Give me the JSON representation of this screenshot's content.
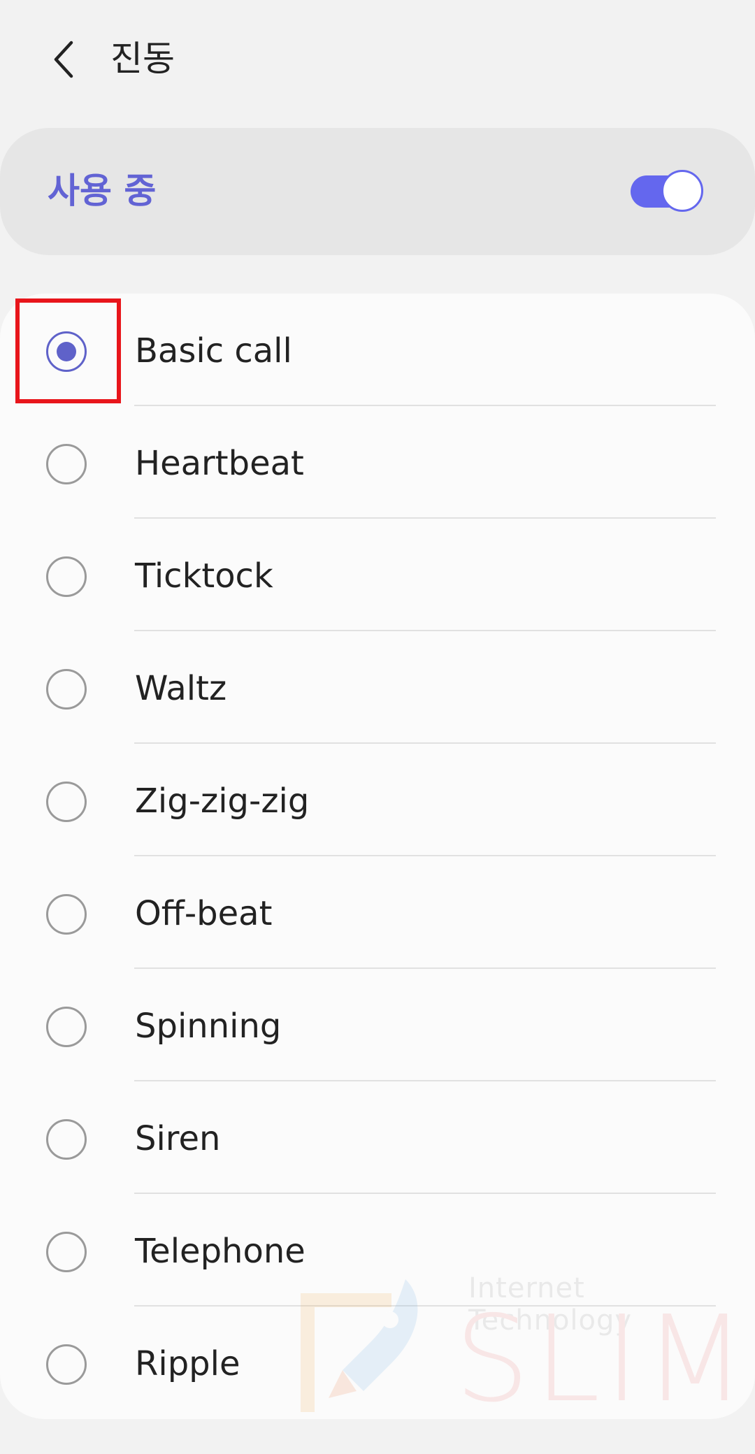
{
  "header": {
    "title": "진동",
    "back_icon": "chevron-left-icon"
  },
  "toggle": {
    "label": "사용 중",
    "enabled": true,
    "accent_color": "#6467ee"
  },
  "vibration_patterns": [
    {
      "label": "Basic call",
      "selected": true
    },
    {
      "label": "Heartbeat",
      "selected": false
    },
    {
      "label": "Ticktock",
      "selected": false
    },
    {
      "label": "Waltz",
      "selected": false
    },
    {
      "label": "Zig-zig-zig",
      "selected": false
    },
    {
      "label": "Off-beat",
      "selected": false
    },
    {
      "label": "Spinning",
      "selected": false
    },
    {
      "label": "Siren",
      "selected": false
    },
    {
      "label": "Telephone",
      "selected": false
    },
    {
      "label": "Ripple",
      "selected": false
    }
  ],
  "annotation": {
    "highlight_color": "#e8151b"
  },
  "watermark": {
    "tagline": "Internet Technology",
    "brand": "SLIM"
  }
}
